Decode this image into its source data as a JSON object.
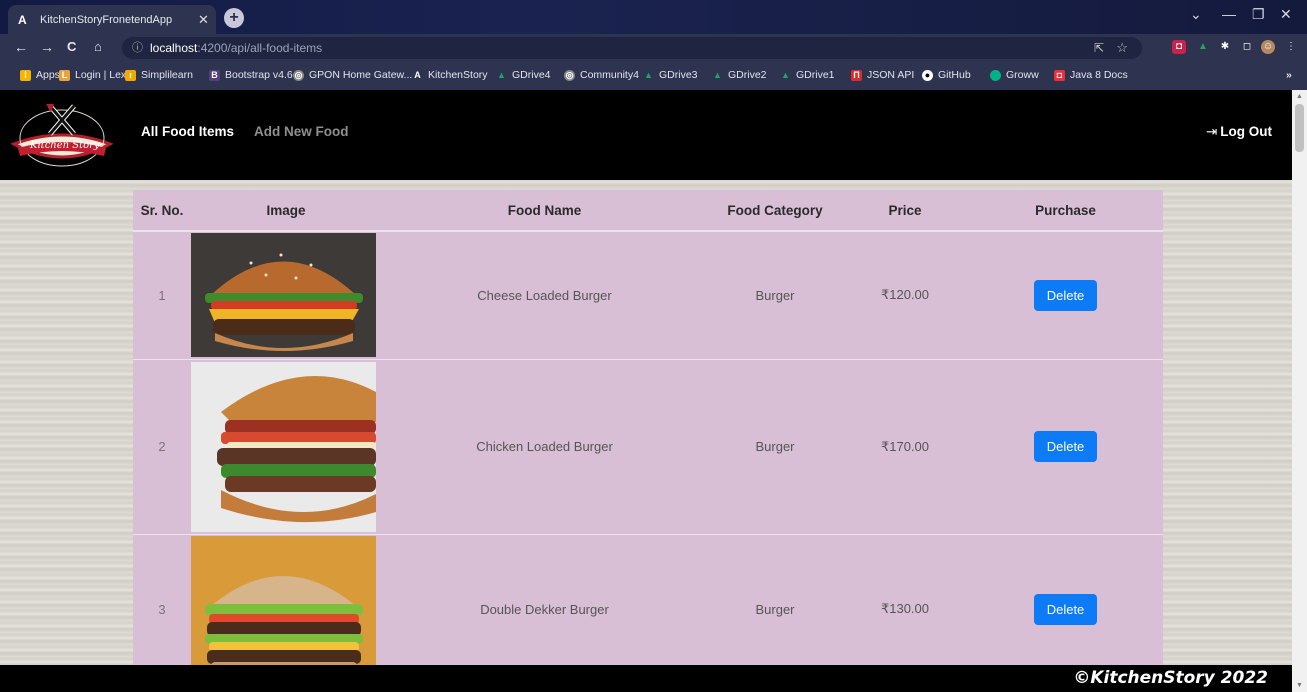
{
  "browser": {
    "tab_title": "KitchenStoryFronetendApp",
    "tab_favicon": "A",
    "url_host": "localhost",
    "url_path": ":4200/api/all-food-items",
    "window_controls": [
      "⌄",
      "—",
      "❐",
      "✕"
    ],
    "bookmarks": [
      {
        "label": "Apps",
        "icon": "apps-icon",
        "color": "#f4b400"
      },
      {
        "label": "Login | Lex",
        "icon": "lex-icon",
        "color": "#e8a33d"
      },
      {
        "label": "Simplilearn",
        "icon": "simplilearn-icon",
        "color": "#f2a900"
      },
      {
        "label": "Bootstrap v4.6",
        "icon": "bootstrap-icon",
        "color": "#563d7c"
      },
      {
        "label": "GPON Home Gatew...",
        "icon": "globe-icon",
        "color": "#888888"
      },
      {
        "label": "KitchenStory",
        "icon": "angular-icon",
        "color": "#2e3350"
      },
      {
        "label": "GDrive4",
        "icon": "gdrive-icon",
        "color": "#1fa463"
      },
      {
        "label": "Community4",
        "icon": "globe-icon",
        "color": "#888888"
      },
      {
        "label": "GDrive3",
        "icon": "gdrive-icon",
        "color": "#1fa463"
      },
      {
        "label": "GDrive2",
        "icon": "gdrive-icon",
        "color": "#1fa463"
      },
      {
        "label": "GDrive1",
        "icon": "gdrive-icon",
        "color": "#1fa463"
      },
      {
        "label": "JSON API",
        "icon": "json-icon",
        "color": "#d92b2b"
      },
      {
        "label": "GitHub",
        "icon": "github-icon",
        "color": "#ffffff"
      },
      {
        "label": "Groww",
        "icon": "groww-icon",
        "color": "#00b386"
      },
      {
        "label": "Java 8 Docs",
        "icon": "java-icon",
        "color": "#e8303a"
      }
    ],
    "bookmarks_overflow": "»"
  },
  "app": {
    "logo_text": "Kitchen Story",
    "nav": {
      "all_food_items": "All Food Items",
      "add_new_food": "Add New Food",
      "logout": "Log Out"
    },
    "table": {
      "headers": [
        "Sr. No.",
        "Image",
        "Food Name",
        "Food Category",
        "Price",
        "Purchase"
      ],
      "rows": [
        {
          "sr": "1",
          "name": "Cheese Loaded Burger",
          "category": "Burger",
          "price": "₹120.00",
          "action": "Delete"
        },
        {
          "sr": "2",
          "name": "Chicken Loaded Burger",
          "category": "Burger",
          "price": "₹170.00",
          "action": "Delete"
        },
        {
          "sr": "3",
          "name": "Double Dekker Burger",
          "category": "Burger",
          "price": "₹130.00",
          "action": "Delete"
        }
      ]
    },
    "footer": "©KitchenStory 2022"
  },
  "colors": {
    "navbar": "#000000",
    "table_bg": "#d9bfd6",
    "delete_button": "#0d7bf5"
  }
}
